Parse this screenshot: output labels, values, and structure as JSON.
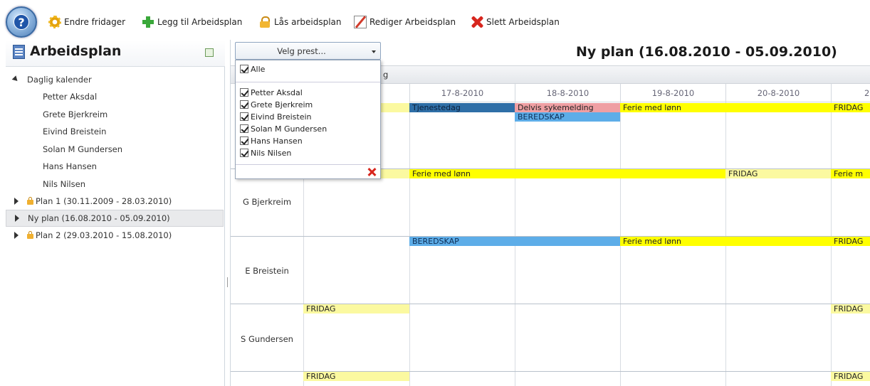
{
  "toolbar": {
    "items": [
      {
        "label": "Endre fridager",
        "icon": "gear-icon"
      },
      {
        "label": "Legg til Arbeidsplan",
        "icon": "plus-icon"
      },
      {
        "label": "Lås arbeidsplan",
        "icon": "lock-icon"
      },
      {
        "label": "Rediger Arbeidsplan",
        "icon": "edit-icon"
      },
      {
        "label": "Slett Arbeidsplan",
        "icon": "delete-icon"
      }
    ]
  },
  "sidebar": {
    "title": "Arbeidsplan",
    "tree": {
      "root_label": "Daglig kalender",
      "people": [
        "Petter  Aksdal",
        "Grete  Bjerkreim",
        "Eivind  Breistein",
        "Solan M Gundersen",
        "Hans  Hansen",
        "Nils  Nilsen"
      ],
      "plans": [
        {
          "label": "Plan 1 (30.11.2009 - 28.03.2010)",
          "locked": true,
          "selected": false
        },
        {
          "label": "Ny plan (16.08.2010 - 05.09.2010)",
          "locked": false,
          "selected": true
        },
        {
          "label": "Plan 2 (29.03.2010 - 15.08.2010)",
          "locked": true,
          "selected": false
        }
      ]
    }
  },
  "main": {
    "plan_title": "Ny plan (16.08.2010 - 05.09.2010)",
    "priest_select": {
      "value": "Velg prest..."
    },
    "band_text": "g",
    "dropdown": {
      "all_label": "Alle",
      "options": [
        "Petter  Aksdal",
        "Grete  Bjerkreim",
        "Eivind  Breistein",
        "Solan M Gundersen",
        "Hans  Hansen",
        "Nils  Nilsen"
      ]
    },
    "days": [
      "17-8-2010",
      "18-8-2010",
      "19-8-2010",
      "20-8-2010",
      "2"
    ],
    "rows": [
      "G Bjerkreim",
      "E Breistein",
      "S Gundersen"
    ],
    "events": {
      "tjenestedag": "Tjenestedag",
      "delvis": "Delvis sykemelding",
      "beredskap1": "BEREDSKAP",
      "ferie1": "Ferie med lønn",
      "fridag_r1_d21": "FRIDAG",
      "ferie2": "Ferie med lønn",
      "fridag2": "FRIDAG",
      "ferie2b": "Ferie m",
      "beredskap2": "BEREDSKAP",
      "ferie3": "Ferie med lønn",
      "fridag3": "FRIDAG",
      "fridag4a": "FRIDAG",
      "fridag4b": "FRIDAG",
      "fridag5a": "FRIDAG",
      "fridag5b": "FRIDAG"
    },
    "colors": {
      "yellow": "#ffff00",
      "pale_yellow": "#fbf9a0",
      "blue": "#5dade8",
      "dark_blue": "#2f6fa7",
      "pink": "#ef9fa3"
    }
  }
}
